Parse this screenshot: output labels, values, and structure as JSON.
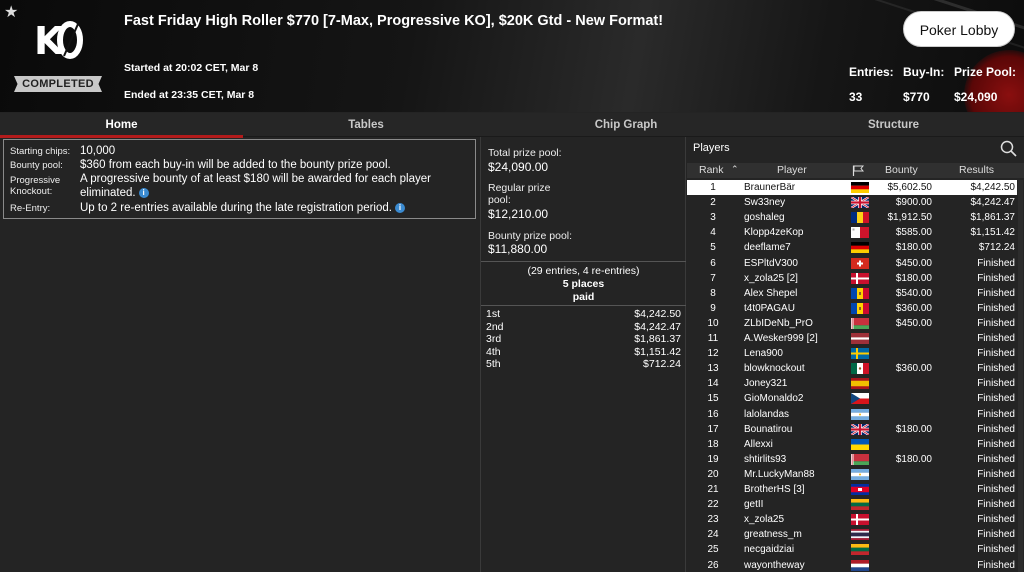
{
  "header": {
    "title": "Fast Friday High Roller $770 [7-Max, Progressive KO], $20K Gtd - New Format!",
    "logo_text": "KO",
    "status": "COMPLETED",
    "started": "Started at 20:02 CET, Mar 8",
    "ended": "Ended at 23:35 CET, Mar 8",
    "lobby_button": "Poker Lobby",
    "stats": {
      "entries_label": "Entries:",
      "entries_value": "33",
      "buyin_label": "Buy-In:",
      "buyin_value": "$770",
      "prizepool_label": "Prize Pool:",
      "prizepool_value": "$24,090"
    }
  },
  "tabs": [
    "Home",
    "Tables",
    "Chip Graph",
    "Structure"
  ],
  "info": {
    "starting_chips_label": "Starting chips:",
    "starting_chips_value": "10,000",
    "bounty_pool_label": "Bounty pool:",
    "bounty_pool_value": "$360 from each buy-in will be added to the bounty prize pool.",
    "progressive_label_1": "Progressive",
    "progressive_label_2": "Knockout:",
    "progressive_value_1": "A progressive bounty of at least $180 will be awarded for each player",
    "progressive_value_2": "eliminated.",
    "reentry_label": "Re-Entry:",
    "reentry_value": "Up to 2 re-entries available during the late registration period."
  },
  "prize": {
    "total_label": "Total prize pool:",
    "total_value": "$24,090.00",
    "regular_label_1": "Regular prize",
    "regular_label_2": "pool:",
    "regular_value": "$12,210.00",
    "bounty_label": "Bounty prize pool:",
    "bounty_value": "$11,880.00",
    "entries_note": "(29 entries, 4 re-entries)",
    "places": "5 places",
    "paid": "paid",
    "payouts": [
      {
        "place": "1st",
        "amount": "$4,242.50"
      },
      {
        "place": "2nd",
        "amount": "$4,242.47"
      },
      {
        "place": "3rd",
        "amount": "$1,861.37"
      },
      {
        "place": "4th",
        "amount": "$1,151.42"
      },
      {
        "place": "5th",
        "amount": "$712.24"
      }
    ]
  },
  "players": {
    "title": "Players",
    "columns": {
      "rank": "Rank",
      "player": "Player",
      "bounty": "Bounty",
      "results": "Results"
    },
    "rows": [
      {
        "rank": "1",
        "name": "BraunerBär",
        "flag": "de",
        "bounty": "$5,602.50",
        "result": "$4,242.50"
      },
      {
        "rank": "2",
        "name": "Sw33ney",
        "flag": "gb",
        "bounty": "$900.00",
        "result": "$4,242.47"
      },
      {
        "rank": "3",
        "name": "goshaleg",
        "flag": "ro",
        "bounty": "$1,912.50",
        "result": "$1,861.37"
      },
      {
        "rank": "4",
        "name": "Klopp4zeKop",
        "flag": "mt",
        "bounty": "$585.00",
        "result": "$1,151.42"
      },
      {
        "rank": "5",
        "name": "deeflame7",
        "flag": "de",
        "bounty": "$180.00",
        "result": "$712.24"
      },
      {
        "rank": "6",
        "name": "ESPltdV300",
        "flag": "ch",
        "bounty": "$450.00",
        "result": "Finished"
      },
      {
        "rank": "7",
        "name": "x_zola25 [2]",
        "flag": "dk",
        "bounty": "$180.00",
        "result": "Finished"
      },
      {
        "rank": "8",
        "name": "Alex Shepel",
        "flag": "md",
        "bounty": "$540.00",
        "result": "Finished"
      },
      {
        "rank": "9",
        "name": "t4t0PAGAU",
        "flag": "md",
        "bounty": "$360.00",
        "result": "Finished"
      },
      {
        "rank": "10",
        "name": "ZLbIDeNb_PrO",
        "flag": "by",
        "bounty": "$450.00",
        "result": "Finished"
      },
      {
        "rank": "11",
        "name": "A.Wesker999 [2]",
        "flag": "lv",
        "bounty": "",
        "result": "Finished"
      },
      {
        "rank": "12",
        "name": "Lena900",
        "flag": "se",
        "bounty": "",
        "result": "Finished"
      },
      {
        "rank": "13",
        "name": "blowknockout",
        "flag": "mx",
        "bounty": "$360.00",
        "result": "Finished"
      },
      {
        "rank": "14",
        "name": "Joney321",
        "flag": "es",
        "bounty": "",
        "result": "Finished"
      },
      {
        "rank": "15",
        "name": "GioMonaldo2",
        "flag": "cz",
        "bounty": "",
        "result": "Finished"
      },
      {
        "rank": "16",
        "name": "lalolandas",
        "flag": "ar",
        "bounty": "",
        "result": "Finished"
      },
      {
        "rank": "17",
        "name": "Bounatirou",
        "flag": "gb",
        "bounty": "$180.00",
        "result": "Finished"
      },
      {
        "rank": "18",
        "name": "Allexxi",
        "flag": "ua",
        "bounty": "",
        "result": "Finished"
      },
      {
        "rank": "19",
        "name": "shtirlits93",
        "flag": "by",
        "bounty": "$180.00",
        "result": "Finished"
      },
      {
        "rank": "20",
        "name": "Mr.LuckyMan88",
        "flag": "ar",
        "bounty": "",
        "result": "Finished"
      },
      {
        "rank": "21",
        "name": "BrotherHS [3]",
        "flag": "kh",
        "bounty": "",
        "result": "Finished"
      },
      {
        "rank": "22",
        "name": "getII",
        "flag": "lt",
        "bounty": "",
        "result": "Finished"
      },
      {
        "rank": "23",
        "name": "x_zola25",
        "flag": "dk",
        "bounty": "",
        "result": "Finished"
      },
      {
        "rank": "24",
        "name": "greatness_m",
        "flag": "th",
        "bounty": "",
        "result": "Finished"
      },
      {
        "rank": "25",
        "name": "necgaidziai",
        "flag": "lt",
        "bounty": "",
        "result": "Finished"
      },
      {
        "rank": "26",
        "name": "wayontheway",
        "flag": "nl",
        "bounty": "",
        "result": "Finished"
      }
    ]
  },
  "colors": {
    "accent": "#b31b1b",
    "info_icon": "#3a8ad0",
    "background": "#242424"
  }
}
